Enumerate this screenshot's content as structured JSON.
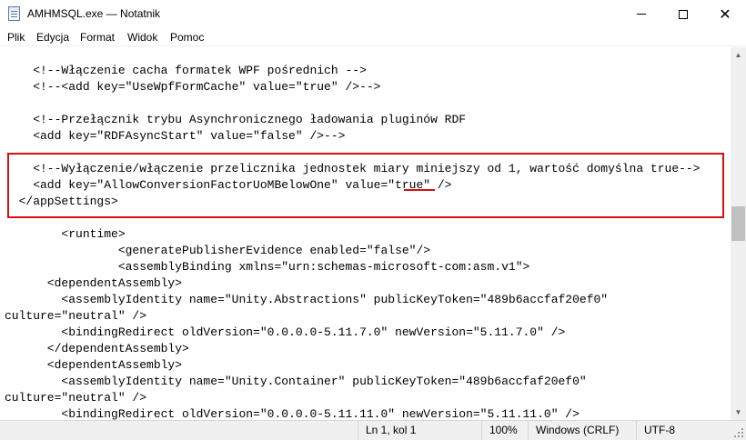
{
  "window": {
    "title": "AMHMSQL.exe — Notatnik",
    "app_icon": "notepad-icon",
    "controls": {
      "minimize": "minimize-icon",
      "maximize": "maximize-icon",
      "close_glyph": "✕"
    }
  },
  "menu": [
    "Plik",
    "Edycja",
    "Format",
    "Widok",
    "Pomoc"
  ],
  "editor": {
    "lines": [
      "",
      "    <!--Włączenie cacha formatek WPF pośrednich -->",
      "    <!--<add key=\"UseWpfFormCache\" value=\"true\" />-->",
      "",
      "    <!--Przełącznik trybu Asynchronicznego ładowania pluginów RDF",
      "    <add key=\"RDFAsyncStart\" value=\"false\" />-->",
      "",
      "    <!--Wyłączenie/włączenie przelicznika jednostek miary miniejszy od 1, wartość domyślna true-->",
      "    <add key=\"AllowConversionFactorUoMBelowOne\" value=\"true\" />",
      "  </appSettings>",
      "",
      "        <runtime>",
      "                <generatePublisherEvidence enabled=\"false\"/>",
      "                <assemblyBinding xmlns=\"urn:schemas-microsoft-com:asm.v1\">",
      "      <dependentAssembly>",
      "        <assemblyIdentity name=\"Unity.Abstractions\" publicKeyToken=\"489b6accfaf20ef0\"",
      "culture=\"neutral\" />",
      "        <bindingRedirect oldVersion=\"0.0.0.0-5.11.7.0\" newVersion=\"5.11.7.0\" />",
      "      </dependentAssembly>",
      "      <dependentAssembly>",
      "        <assemblyIdentity name=\"Unity.Container\" publicKeyToken=\"489b6accfaf20ef0\"",
      "culture=\"neutral\" />",
      "        <bindingRedirect oldVersion=\"0.0.0.0-5.11.11.0\" newVersion=\"5.11.11.0\" />"
    ],
    "highlight_color": "#d41111"
  },
  "status": {
    "position": "Ln 1, kol 1",
    "zoom": "100%",
    "line_ending": "Windows (CRLF)",
    "encoding": "UTF-8"
  }
}
